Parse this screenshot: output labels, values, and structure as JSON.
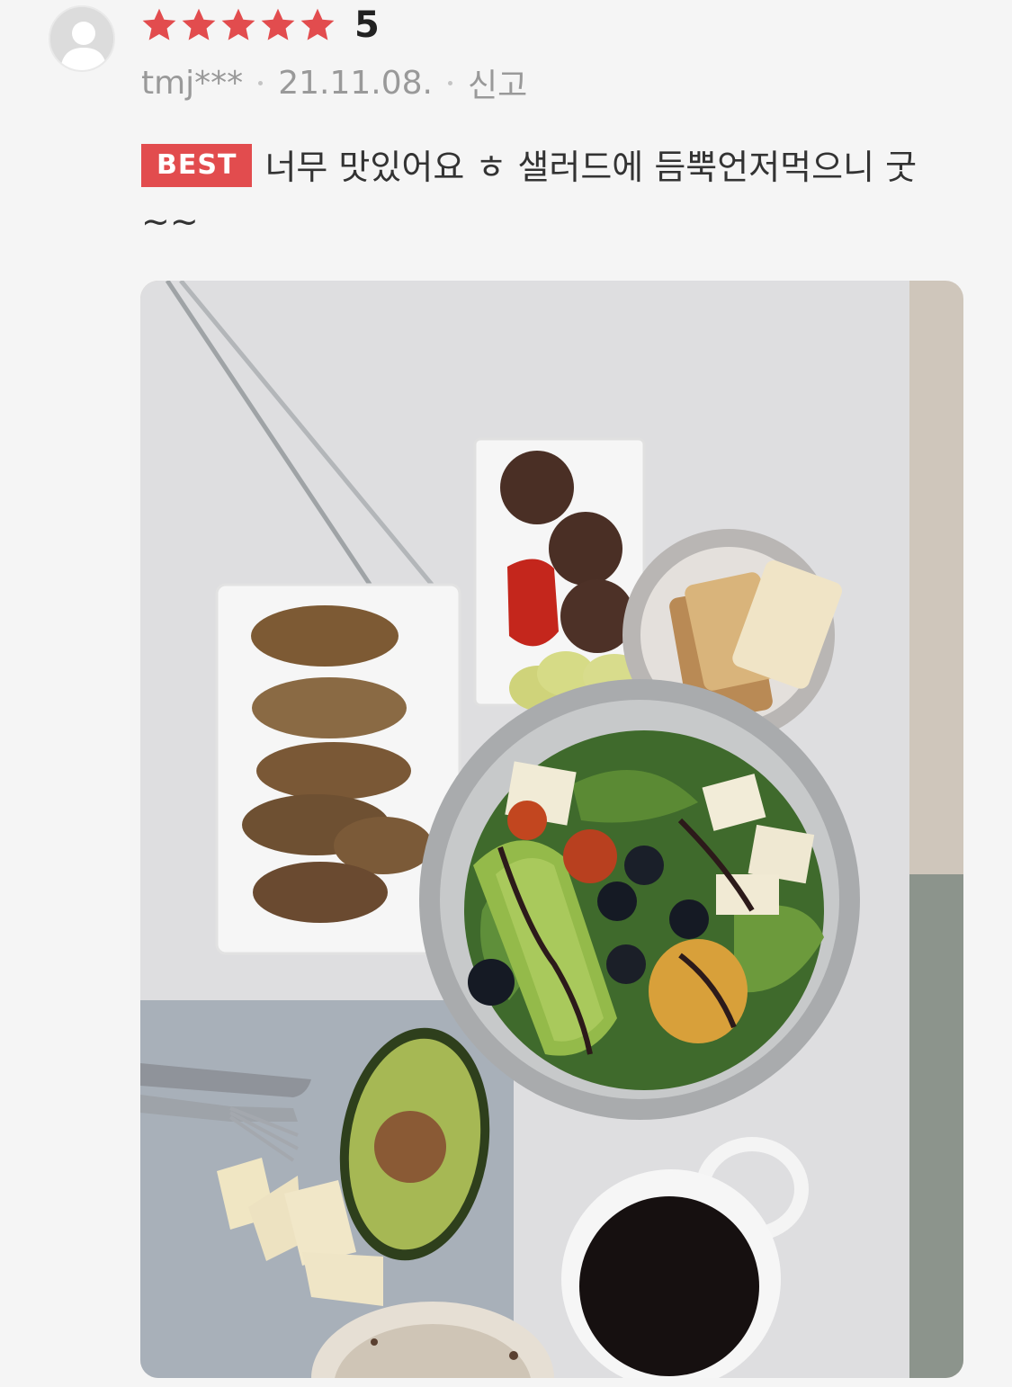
{
  "review": {
    "rating": 5,
    "rating_text": "5",
    "username": "tmj***",
    "date": "21.11.08.",
    "report_label": "신고",
    "badge": "BEST",
    "text": "너무 맛있어요 ㅎ 샐러드에 듬뿍언저먹으니 굿~~",
    "photo_icon": "review-photo"
  },
  "colors": {
    "star": "#e24c4e",
    "badge_bg": "#e24c4e",
    "meta_text": "#999999"
  }
}
